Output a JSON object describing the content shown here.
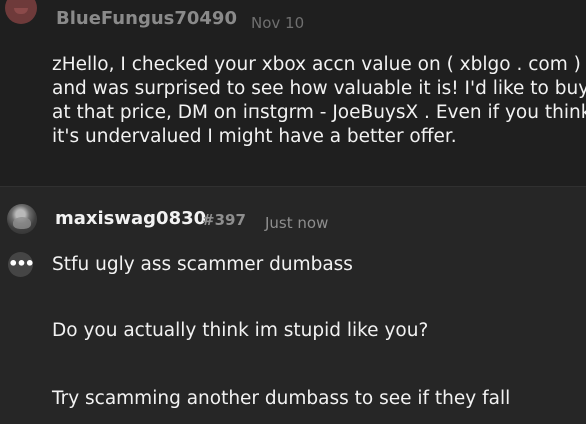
{
  "messages": [
    {
      "author": "BlueFungus70490",
      "timestamp": "Nov 10",
      "body": "zHello, I checked your xbox accn value on ( xblgo . com )\nand was surprised to see how valuable it is! I'd like to buy\nat that price, DM on iпstgrm - JoeBuysX . Even if you think\nit's undervalued I might have a better offer."
    },
    {
      "author": "maxiswag0830",
      "tag": "#397",
      "timestamp": "Just now",
      "lines": [
        "Stfu ugly ass scammer dumbass",
        "Do you actually think im stupid like you?",
        "Try scamming another dumbass to see if they fall"
      ]
    }
  ],
  "message_actions_icon": "more-options-icon",
  "colors": {
    "background": "#262626",
    "quoted_message_background": "#1f1f1f"
  }
}
